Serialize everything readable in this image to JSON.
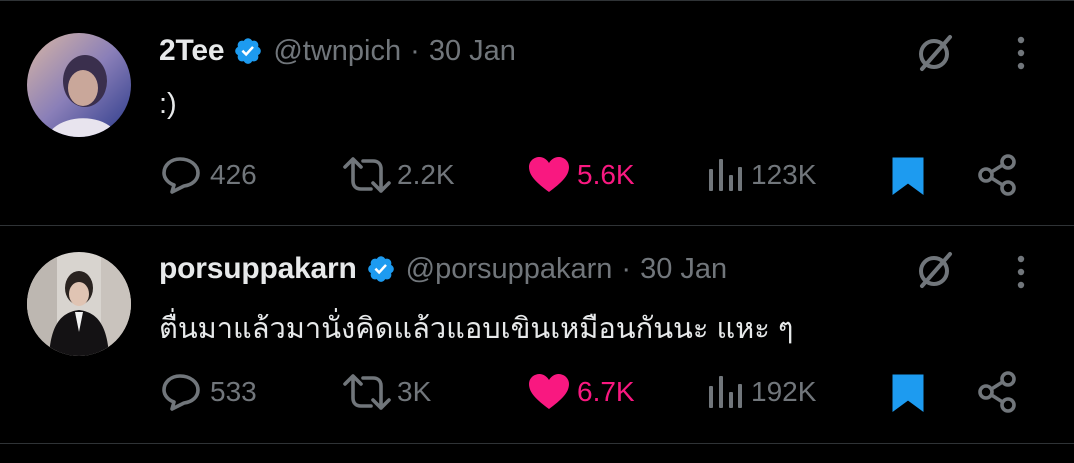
{
  "tweets": [
    {
      "name": "2Tee",
      "handle": "@twnpich",
      "separator": "·",
      "date": "30 Jan",
      "text": ":)",
      "replies": "426",
      "reposts": "2.2K",
      "likes": "5.6K",
      "views": "123K",
      "liked": true,
      "bookmarked": true
    },
    {
      "name": "porsuppakarn",
      "handle": "@porsuppakarn",
      "separator": "·",
      "date": "30 Jan",
      "text": "ตื่นมาแล้วมานั่งคิดแล้วแอบเขินเหมือนกันนะ แหะ ๆ",
      "replies": "533",
      "reposts": "3K",
      "likes": "6.7K",
      "views": "192K",
      "liked": true,
      "bookmarked": true
    }
  ],
  "icons": {
    "verified": "verified-badge-icon",
    "grok": "grok-icon",
    "more": "more-dots-icon",
    "reply": "reply-icon",
    "repost": "repost-icon",
    "like": "heart-icon",
    "views": "views-icon",
    "bookmark": "bookmark-icon",
    "share": "share-icon"
  },
  "colors": {
    "background": "#000000",
    "text": "#e7e9ea",
    "muted": "#71767b",
    "like": "#f91880",
    "verified": "#1d9bf0",
    "divider": "#2f3336"
  }
}
